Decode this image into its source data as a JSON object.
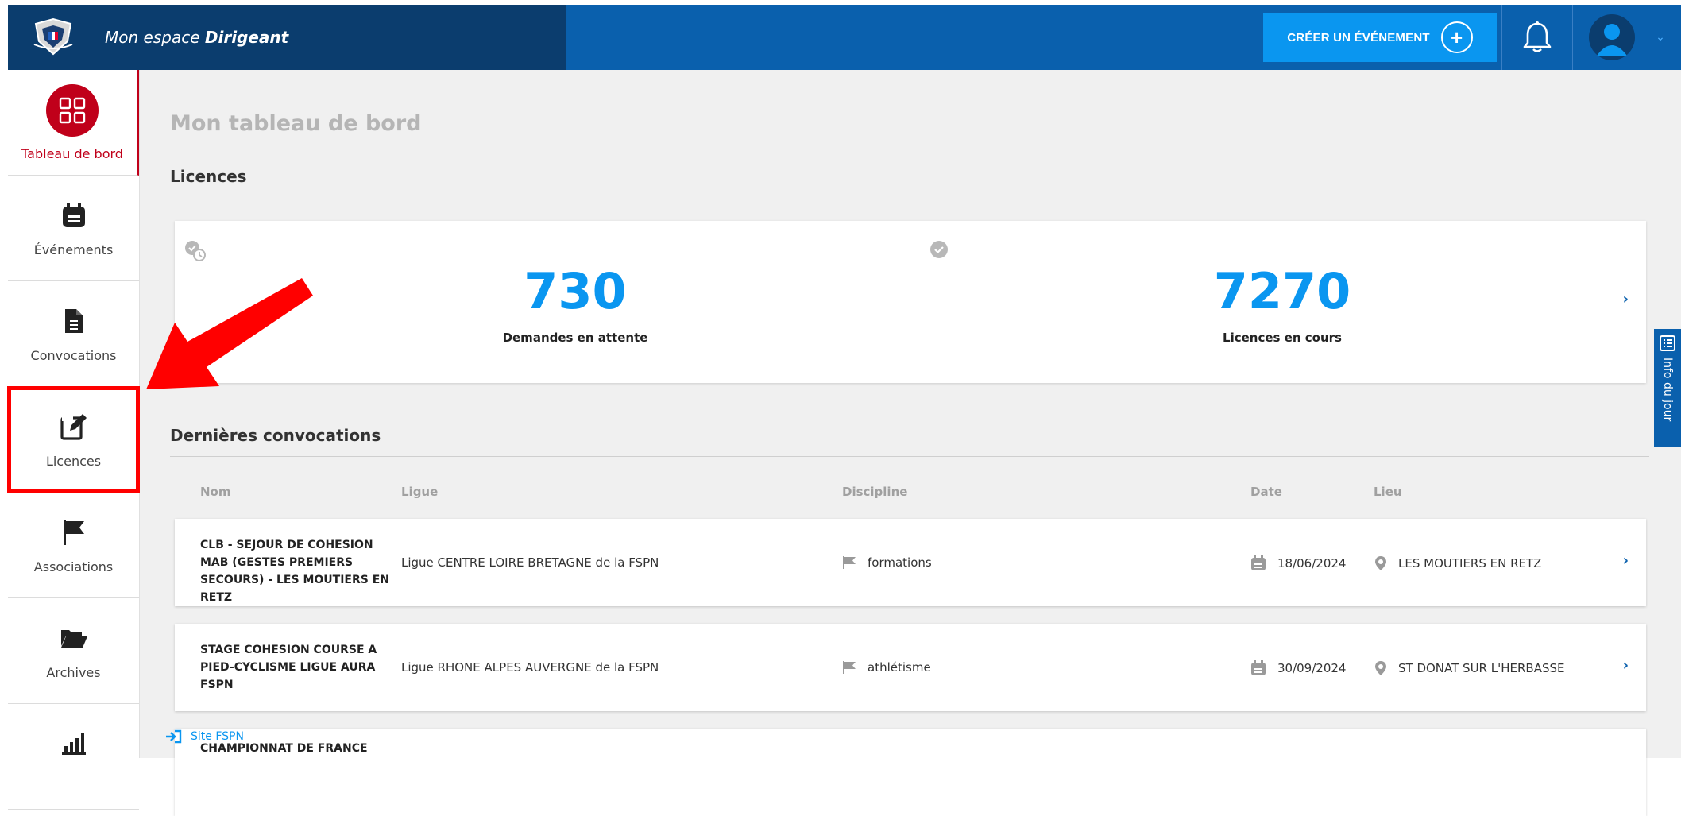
{
  "header": {
    "title_prefix": "Mon espace",
    "title_strong": "Dirigeant",
    "create_event_label": "CRÉER UN ÉVÉNEMENT"
  },
  "sidebar": {
    "items": [
      {
        "label": "Tableau de bord",
        "icon": "dashboard-icon",
        "active": true
      },
      {
        "label": "Événements",
        "icon": "calendar-icon"
      },
      {
        "label": "Convocations",
        "icon": "document-icon"
      },
      {
        "label": "Licences",
        "icon": "edit-icon",
        "highlighted": true
      },
      {
        "label": "Associations",
        "icon": "flag-icon"
      },
      {
        "label": "Archives",
        "icon": "folder-open-icon"
      },
      {
        "label": "",
        "icon": "bar-chart-icon"
      }
    ]
  },
  "main": {
    "page_title": "Mon tableau de bord",
    "licences_title": "Licences",
    "stats": [
      {
        "value": "730",
        "label": "Demandes en attente",
        "icon": "clock-check-icon"
      },
      {
        "value": "7270",
        "label": "Licences en cours",
        "icon": "check-circle-icon"
      }
    ],
    "convocations_title": "Dernières convocations",
    "columns": [
      "Nom",
      "Ligue",
      "Discipline",
      "Date",
      "Lieu"
    ],
    "rows": [
      {
        "nom": "CLB - SEJOUR DE COHESION MAB (GESTES PREMIERS SECOURS) - LES MOUTIERS EN RETZ",
        "ligue": "Ligue CENTRE LOIRE BRETAGNE de la FSPN",
        "discipline": "formations",
        "date": "18/06/2024",
        "lieu": "LES MOUTIERS EN RETZ"
      },
      {
        "nom": "STAGE COHESION COURSE A PIED-CYCLISME LIGUE AURA FSPN",
        "ligue": "Ligue RHONE ALPES AUVERGNE de la FSPN",
        "discipline": "athlétisme",
        "date": "30/09/2024",
        "lieu": "ST DONAT SUR L'HERBASSE"
      },
      {
        "nom": "CHAMPIONNAT DE FRANCE",
        "ligue": "",
        "discipline": "",
        "date": "",
        "lieu": ""
      }
    ]
  },
  "info_tab": "Info du jour",
  "site_link": "Site FSPN",
  "colors": {
    "brand_dark": "#0b3d6e",
    "brand_blue": "#0a60ad",
    "accent": "#0a96f0",
    "active_red": "#c0001a",
    "highlight": "#ff0000"
  }
}
